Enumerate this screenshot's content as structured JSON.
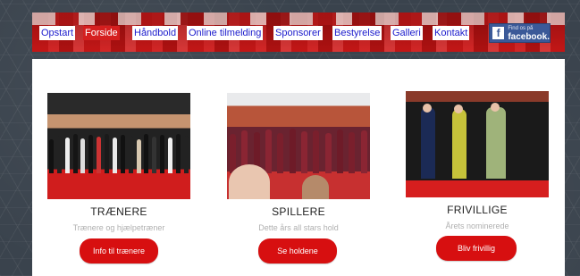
{
  "nav": {
    "items": [
      {
        "label": "Opstart",
        "active": false
      },
      {
        "label": "Forside",
        "active": true
      },
      {
        "label": "Håndbold",
        "active": false
      },
      {
        "label": "Online tilmelding",
        "active": false
      },
      {
        "label": "Sponsorer",
        "active": false
      },
      {
        "label": "Bestyrelse",
        "active": false
      },
      {
        "label": "Galleri",
        "active": false
      },
      {
        "label": "Kontakt",
        "active": false
      }
    ]
  },
  "facebook": {
    "small": "Find os på",
    "big": "facebook.",
    "logo": "f"
  },
  "cards": [
    {
      "title": "TRÆNERE",
      "subtitle": "Trænere og hjælpetræner",
      "button": "Info til trænere"
    },
    {
      "title": "SPILLERE",
      "subtitle": "Dette års all stars hold",
      "button": "Se holdene"
    },
    {
      "title": "FRIVILLIGE",
      "subtitle": "Årets nominerede",
      "button": "Bliv frivillig"
    }
  ],
  "colors": {
    "accent": "#d70f10",
    "nav_link": "#1b1bcc",
    "facebook": "#3b5998"
  }
}
